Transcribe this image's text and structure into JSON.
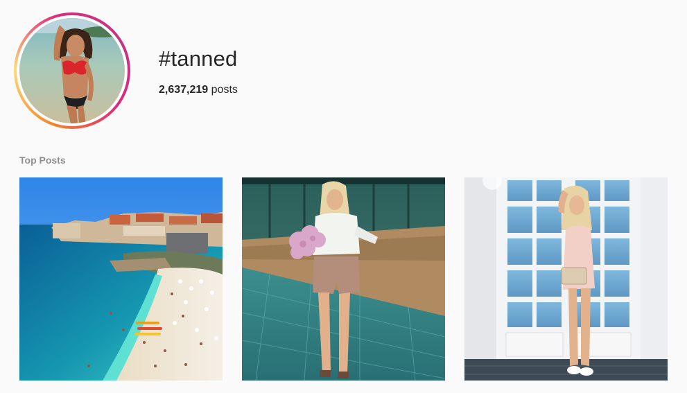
{
  "hashtag": {
    "title": "#tanned",
    "post_count": "2,637,219",
    "post_count_suffix": "posts",
    "ring_colors": [
      "#f58529",
      "#dd2a7b",
      "#c13584"
    ]
  },
  "top_posts": {
    "label": "Top Posts",
    "posts": [
      {
        "subject": "coastal town beach with turquoise water"
      },
      {
        "subject": "woman holding pink flowers on tiled terrace"
      },
      {
        "subject": "woman in pink outfit in front of white window doors"
      }
    ]
  }
}
